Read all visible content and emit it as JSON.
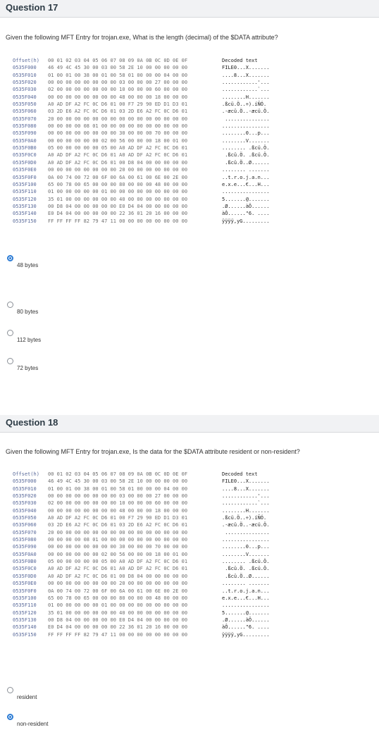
{
  "q17": {
    "title": "Question 17",
    "text": "Given the following MFT Entry for trojan.exe, What is the length (decimal) of the $DATA attribute?",
    "answers": [
      {
        "label": "48 bytes",
        "selected": true
      },
      {
        "label": "80 bytes",
        "selected": false
      },
      {
        "label": "112 bytes",
        "selected": false
      },
      {
        "label": "72 bytes",
        "selected": false
      }
    ]
  },
  "q18": {
    "title": "Question 18",
    "text": "Given the following MFT Entry for trojan.exe, Is the data for the $DATA attribute resident or non-resident?",
    "answers": [
      {
        "label": "resident",
        "selected": false
      },
      {
        "label": "non-resident",
        "selected": true
      }
    ]
  },
  "hex_dump": {
    "header_offset": "Offset(h)",
    "header_bytes": "00 01 02 03 04 05 06 07 08 09 0A 0B 0C 0D 0E 0F",
    "header_decoded": "Decoded text",
    "rows": [
      {
        "offset": "0535F000",
        "bytes": "46 49 4C 45 30 00 03 00 58 2E 10 00 00 00 00 00",
        "decoded": "FILE0...X......."
      },
      {
        "offset": "0535F010",
        "bytes": "01 00 01 00 38 00 01 00 58 01 00 00 00 04 00 00",
        "decoded": "....8...X......."
      },
      {
        "offset": "0535F020",
        "bytes": "00 00 00 00 00 00 00 00 03 00 00 00 27 00 00 00",
        "decoded": "............'..."
      },
      {
        "offset": "0535F030",
        "bytes": "02 00 00 00 00 00 00 00 10 00 00 00 60 00 00 00",
        "decoded": "............`..."
      },
      {
        "offset": "0535F040",
        "bytes": "00 00 00 00 00 00 00 00 48 00 00 00 18 00 00 00",
        "decoded": "........H......."
      },
      {
        "offset": "0535F050",
        "bytes": "A0 AD DF A2 FC 0C D6 01 00 F7 29 90 ED D1 D3 01",
        "decoded": ".ßcü.Ö..÷).íÑÓ."
      },
      {
        "offset": "0535F060",
        "bytes": "03 2D E6 A2 FC 0C D6 01 03 2D E6 A2 FC 0C D6 01",
        "decoded": ".-æcü.Ö..-æcü.Ö."
      },
      {
        "offset": "0535F070",
        "bytes": "20 00 00 00 00 00 00 00 00 00 00 00 00 00 00 00",
        "decoded": " ..............."
      },
      {
        "offset": "0535F080",
        "bytes": "00 00 00 00 08 01 00 00 00 00 00 00 00 00 00 00",
        "decoded": "................"
      },
      {
        "offset": "0535F090",
        "bytes": "00 00 00 00 00 00 00 00 30 00 00 00 70 00 00 00",
        "decoded": "........0...p..."
      },
      {
        "offset": "0535F0A0",
        "bytes": "00 00 00 00 00 00 02 00 56 00 00 00 18 00 01 00",
        "decoded": "........V......."
      },
      {
        "offset": "0535F0B0",
        "bytes": "05 00 00 00 00 00 05 00 A0 AD DF A2 FC 0C D6 01",
        "decoded": "........ .ßcü.Ö."
      },
      {
        "offset": "0535F0C0",
        "bytes": "A0 AD DF A2 FC 0C D6 01 A0 AD DF A2 FC 0C D6 01",
        "decoded": " .ßcü.Ö. .ßcü.Ö."
      },
      {
        "offset": "0535F0D0",
        "bytes": "A0 AD DF A2 FC 0C D6 01 00 D8 04 00 00 00 00 00",
        "decoded": " .ßcü.Ö..Ø......"
      },
      {
        "offset": "0535F0E0",
        "bytes": "00 00 00 00 00 00 00 00 20 00 00 00 00 00 00 00",
        "decoded": "........ ......."
      },
      {
        "offset": "0535F0F0",
        "bytes": "0A 00 74 00 72 00 6F 00 6A 00 61 00 6E 00 2E 00",
        "decoded": "..t.r.o.j.a.n..."
      },
      {
        "offset": "0535F100",
        "bytes": "65 00 78 00 65 00 00 00 80 00 00 00 48 00 00 00",
        "decoded": "e.x.e...€...H..."
      },
      {
        "offset": "0535F110",
        "bytes": "01 00 00 00 00 00 01 00 00 00 00 00 00 00 00 00",
        "decoded": "................"
      },
      {
        "offset": "0535F120",
        "bytes": "35 01 00 00 00 00 00 00 40 00 00 00 00 00 00 00",
        "decoded": "5.......@......."
      },
      {
        "offset": "0535F130",
        "bytes": "00 D8 04 00 00 00 00 00 E0 D4 04 00 00 00 00 00",
        "decoded": ".Ø......àÔ......"
      },
      {
        "offset": "0535F140",
        "bytes": "E0 D4 04 00 00 00 00 00 22 36 01 20 16 00 00 00",
        "decoded": "àÔ......\"6. ...."
      },
      {
        "offset": "0535F150",
        "bytes": "FF FF FF FF 82 79 47 11 00 00 00 00 00 00 00 00",
        "decoded": "ÿÿÿÿ‚yG........."
      }
    ]
  }
}
